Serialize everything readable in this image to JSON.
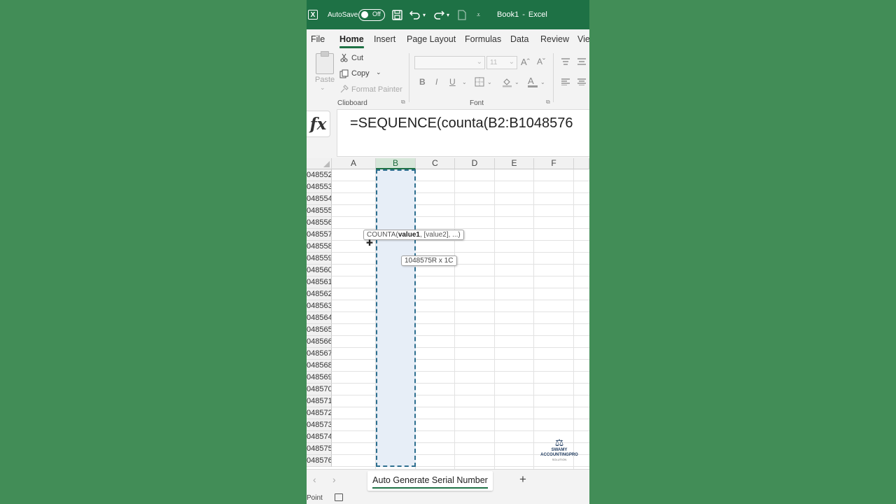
{
  "app": {
    "title": "Book1",
    "app_name": "Excel",
    "title_separator": "-",
    "autosave_label": "AutoSave",
    "autosave_state": "Off"
  },
  "tabs": [
    "File",
    "Home",
    "Insert",
    "Page Layout",
    "Formulas",
    "Data",
    "Review",
    "Vie"
  ],
  "active_tab": "Home",
  "ribbon": {
    "paste": "Paste",
    "cut": "Cut",
    "copy": "Copy",
    "format_painter": "Format Painter",
    "clipboard_group": "Clipboard",
    "font_group": "Font",
    "font_size": "11",
    "bold": "B",
    "italic": "I",
    "underline": "U",
    "grow_font": "Aˆ",
    "shrink_font": "Aˇ",
    "font_color": "A"
  },
  "formula_bar": {
    "fx": "fx",
    "formula": "=SEQUENCE(counta(B2:B1048576"
  },
  "grid": {
    "columns": [
      "A",
      "B",
      "C",
      "D",
      "E",
      "F"
    ],
    "selected_column": "B",
    "rows": [
      "048552",
      "048553",
      "048554",
      "048555",
      "048556",
      "048557",
      "048558",
      "048559",
      "048560",
      "048561",
      "048562",
      "048563",
      "048564",
      "048565",
      "048566",
      "048567",
      "048568",
      "048569",
      "048570",
      "048571",
      "048572",
      "048573",
      "048574",
      "048575",
      "048576"
    ]
  },
  "tooltips": {
    "function_name": "COUNTA(",
    "function_arg1": "value1",
    "function_rest": ", [value2], ...)",
    "selection_size": "1048575R x 1C"
  },
  "watermark": {
    "name": "SWAMY ACCOUNTINGPRO",
    "sub": "SOLUTION"
  },
  "sheets": [
    "Auto Generate Serial Number"
  ],
  "status": {
    "mode": "Point"
  },
  "icons": {
    "excel_logo": "excel-logo-icon",
    "save": "save-icon",
    "undo": "undo-icon",
    "redo": "redo-icon",
    "cut": "scissors-icon",
    "copy": "copy-icon",
    "format_painter": "paintbrush-icon",
    "borders": "borders-icon",
    "fill_color": "fill-bucket-icon",
    "align": "align-icon",
    "add_sheet": "plus-icon",
    "accessibility": "accessibility-icon"
  },
  "colors": {
    "title_bar": "#1e7145",
    "background": "#428d57",
    "selection_fill": "#e7eef7",
    "selection_border": "#2e6f8f"
  }
}
